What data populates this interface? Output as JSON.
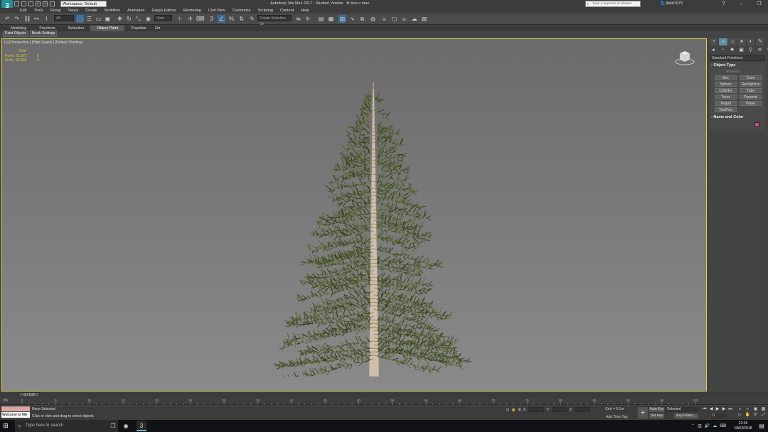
{
  "titlebar": {
    "workspace": "Workspace: Default",
    "title": "Autodesk 3ds Max 2017 - Student Version   fir tree c.max",
    "search_placeholder": "Type a keyword or phrase",
    "user": "jfield1979"
  },
  "menus": [
    "Edit",
    "Tools",
    "Group",
    "Views",
    "Create",
    "Modifiers",
    "Animation",
    "Graph Editors",
    "Rendering",
    "Civil View",
    "Customize",
    "Scripting",
    "Content",
    "Help"
  ],
  "toolbar": {
    "filter_value": "All",
    "refcoord_value": "View",
    "named_selection": "Create Selection Se"
  },
  "ribbon": {
    "tabs": [
      "Modeling",
      "Freeform",
      "Selection",
      "Object Paint",
      "Populate"
    ],
    "subtabs": [
      "Paint Objects",
      "Brush Settings"
    ]
  },
  "viewport": {
    "label": "[+] [Perspective ] [High Quality ] [Default Shading ]",
    "stats": {
      "header": "Total",
      "polys_label": "Polys:",
      "polys_value": "21,972",
      "polys_sel": "0",
      "verts_label": "Verts:",
      "verts_value": "62,904",
      "verts_sel": "0"
    }
  },
  "command_panel": {
    "dropdown": "Standard Primitives",
    "object_type_title": "Object Type",
    "autogrid": "AutoGrid",
    "primitives": [
      "Box",
      "Cone",
      "Sphere",
      "GeoSphere",
      "Cylinder",
      "Tube",
      "Torus",
      "Pyramid",
      "Teapot",
      "Plane",
      "TextPlus"
    ],
    "name_color_title": "Name and Color",
    "swatch_color": "#d1478f"
  },
  "timeline": {
    "frame_display": "0 / 100",
    "ticks": [
      "0",
      "5",
      "10",
      "15",
      "20",
      "25",
      "30",
      "35",
      "40",
      "45",
      "50",
      "55",
      "60",
      "65",
      "70",
      "75",
      "80",
      "85",
      "90",
      "95",
      "100"
    ]
  },
  "status": {
    "percent": "0%",
    "script_text": "Welcome to MA",
    "selection": "None Selected",
    "prompt": "Click or click-and-drag to select objects",
    "x_label": "X:",
    "y_label": "Y:",
    "z_label": "Z:",
    "grid": "Grid = 0.1m",
    "add_time_tag": "Add Time Tag",
    "auto_key": "Auto Key",
    "set_key": "Set Key",
    "selected": "Selected",
    "key_filters": "Key Filters...",
    "frame": "0"
  },
  "taskbar": {
    "search_placeholder": "Type here to search",
    "time": "22:36",
    "date": "18/02/2018"
  }
}
